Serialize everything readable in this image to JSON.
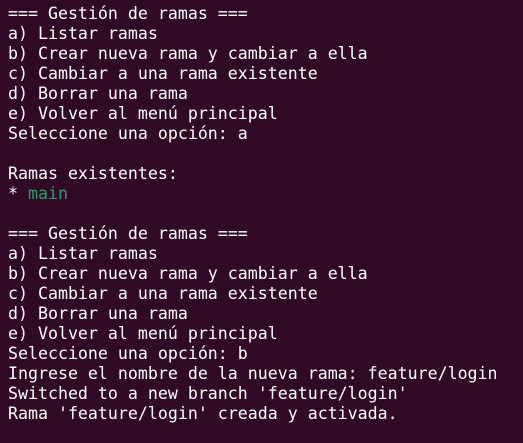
{
  "terminal": {
    "lines": [
      {
        "text": "=== Gestión de ramas ==="
      },
      {
        "text": "a) Listar ramas"
      },
      {
        "text": "b) Crear nueva rama y cambiar a ella"
      },
      {
        "text": "c) Cambiar a una rama existente"
      },
      {
        "text": "d) Borrar una rama"
      },
      {
        "text": "e) Volver al menú principal"
      },
      {
        "text": "Seleccione una opción: a"
      },
      {
        "text": ""
      },
      {
        "text": "Ramas existentes:"
      },
      {
        "prefix": "* ",
        "branch": "main"
      },
      {
        "text": ""
      },
      {
        "text": "=== Gestión de ramas ==="
      },
      {
        "text": "a) Listar ramas"
      },
      {
        "text": "b) Crear nueva rama y cambiar a ella"
      },
      {
        "text": "c) Cambiar a una rama existente"
      },
      {
        "text": "d) Borrar una rama"
      },
      {
        "text": "e) Volver al menú principal"
      },
      {
        "text": "Seleccione una opción: b"
      },
      {
        "text": "Ingrese el nombre de la nueva rama: feature/login"
      },
      {
        "text": "Switched to a new branch 'feature/login'"
      },
      {
        "text": "Rama 'feature/login' creada y activada."
      }
    ]
  },
  "colors": {
    "background": "#300a24",
    "foreground": "#ffffff",
    "branch": "#26a269"
  }
}
